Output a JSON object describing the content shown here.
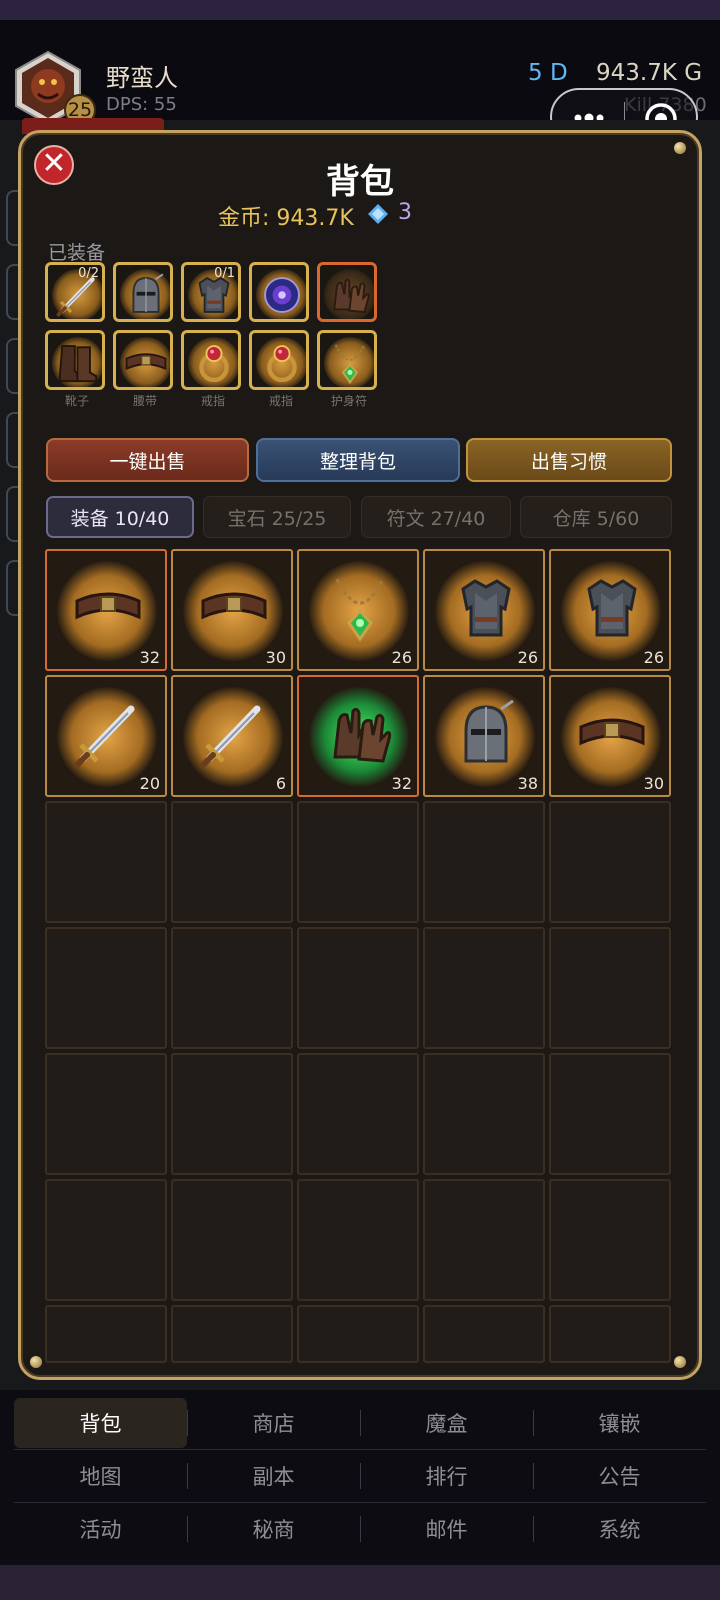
{
  "header": {
    "name": "野蛮人",
    "level": "25",
    "dps": "DPS: 55",
    "d_count": "5 D",
    "gold": "943.7K G",
    "kill": "Kill 7380"
  },
  "panel": {
    "title": "背包",
    "coins": "金币: 943.7K",
    "gem_count": "3",
    "equipped_label": "已装备",
    "equipped": [
      {
        "icon": "sword-icon",
        "count": "0/2",
        "rarity": "gold"
      },
      {
        "icon": "helmet-icon",
        "count": "",
        "rarity": "gold"
      },
      {
        "icon": "armor-icon",
        "count": "0/1",
        "rarity": "gold"
      },
      {
        "icon": "orb-icon",
        "count": "",
        "rarity": "gold"
      },
      {
        "icon": "gloves-icon",
        "count": "",
        "rarity": "orange"
      },
      {
        "icon": "boots-icon",
        "count": "",
        "rarity": "gold",
        "label": "靴子"
      },
      {
        "icon": "belt-icon",
        "count": "",
        "rarity": "gold",
        "label": "腰带"
      },
      {
        "icon": "ring-icon",
        "count": "",
        "rarity": "gold",
        "label": "戒指"
      },
      {
        "icon": "ring-icon",
        "count": "",
        "rarity": "gold",
        "label": "戒指"
      },
      {
        "icon": "amulet-icon",
        "count": "",
        "rarity": "gold",
        "label": "护身符"
      }
    ],
    "buttons": {
      "sell_all": "一键出售",
      "sort": "整理背包",
      "sell_habit": "出售习惯"
    },
    "tabs": [
      {
        "label": "装备 10/40",
        "active": true
      },
      {
        "label": "宝石 25/25",
        "active": false
      },
      {
        "label": "符文 27/40",
        "active": false
      },
      {
        "label": "仓库 5/60",
        "active": false
      }
    ],
    "inventory": [
      {
        "icon": "belt-icon",
        "level": "32",
        "rarity": "orange"
      },
      {
        "icon": "belt-icon",
        "level": "30",
        "rarity": "gold"
      },
      {
        "icon": "amulet-icon",
        "level": "26",
        "rarity": "gold"
      },
      {
        "icon": "armor-icon",
        "level": "26",
        "rarity": "gold"
      },
      {
        "icon": "armor-icon",
        "level": "26",
        "rarity": "gold"
      },
      {
        "icon": "sword-icon",
        "level": "20",
        "rarity": "gold"
      },
      {
        "icon": "sword-icon",
        "level": "6",
        "rarity": "gold"
      },
      {
        "icon": "gloves-icon",
        "level": "32",
        "rarity": "orange",
        "glow": "green"
      },
      {
        "icon": "helmet-icon",
        "level": "38",
        "rarity": "gold"
      },
      {
        "icon": "belt-icon",
        "level": "30",
        "rarity": "gold"
      }
    ]
  },
  "nav": {
    "rows": [
      [
        "背包",
        "商店",
        "魔盒",
        "镶嵌"
      ],
      [
        "地图",
        "副本",
        "排行",
        "公告"
      ],
      [
        "活动",
        "秘商",
        "邮件",
        "系统"
      ]
    ],
    "active": "背包"
  }
}
